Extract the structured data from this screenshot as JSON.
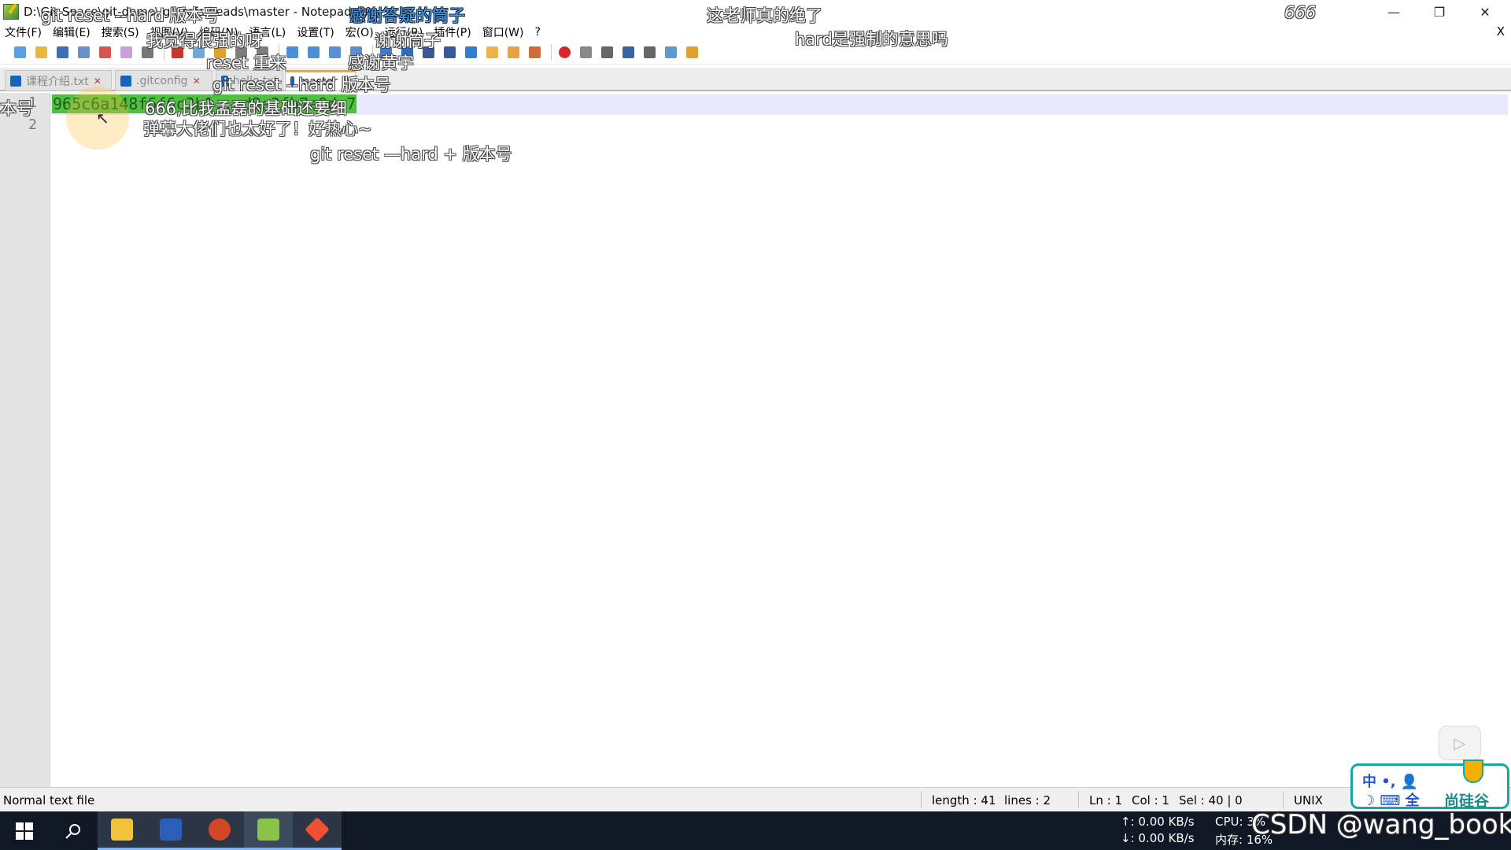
{
  "window": {
    "title": "D:\\Git-Space\\git-demo\\.git\\refs\\heads\\master - Notepad++",
    "minimize_icon": "minimize-icon",
    "restore_icon": "restore-icon",
    "close_icon": "close-icon"
  },
  "menu": {
    "items": [
      "文件(F)",
      "编辑(E)",
      "搜索(S)",
      "视图(V)",
      "编码(N)",
      "语言(L)",
      "设置(T)",
      "宏(O)",
      "运行(R)",
      "插件(P)",
      "窗口(W)",
      "?"
    ],
    "close_document": "X"
  },
  "toolbar": {
    "buttons": [
      "new-icon",
      "open-icon",
      "save-icon",
      "save-all-icon",
      "close-icon",
      "close-all-icon",
      "print-icon",
      "cut-icon",
      "copy-icon",
      "paste-icon",
      "undo-icon",
      "redo-icon",
      "find-icon",
      "replace-icon",
      "zoom-in-icon",
      "zoom-out-icon",
      "sync-icon",
      "wrap-icon",
      "show-all-icon",
      "indent-guide-icon",
      "doc-map-icon",
      "function-list-icon",
      "folder-workspace-icon",
      "monitor-icon",
      "record-macro-icon",
      "stop-macro-icon",
      "play-macro-icon",
      "run-macro-multiple-icon",
      "save-macro-icon",
      "window-icon",
      "folder-icon"
    ]
  },
  "tabs": [
    {
      "label": "课程介绍.txt",
      "active": false
    },
    {
      "label": ".gitconfig",
      "active": false
    },
    {
      "label": "hello.txt",
      "active": false
    },
    {
      "label": "master",
      "active": true
    }
  ],
  "editor": {
    "line_numbers": [
      "1",
      "2"
    ],
    "lines": [
      "965c6a148f6f6c2b1...d9e2fb7a0dc7",
      ""
    ],
    "selected_text": "965c6a148f6f6c2b1...d9e2fb7a0dc7"
  },
  "danmaku": [
    {
      "text": "git reset --hard 版本号",
      "color": "white"
    },
    {
      "text": "感谢答疑的筒子",
      "color": "blue"
    },
    {
      "text": "这老师真的绝了",
      "color": "white"
    },
    {
      "text": "666",
      "color": "white"
    },
    {
      "text": "hard是强制的意思吗",
      "color": "white"
    },
    {
      "text": "我觉得很强的呀",
      "color": "white"
    },
    {
      "text": "谢谢筒子",
      "color": "white"
    },
    {
      "text": "reset 重来",
      "color": "white"
    },
    {
      "text": "感谢黄宇",
      "color": "white"
    },
    {
      "text": "git reset --hard 版本号",
      "color": "white"
    },
    {
      "text": "本号",
      "color": "white"
    },
    {
      "text": "666,比我孟磊的基础还要细",
      "color": "white"
    },
    {
      "text": "弹幕大佬们也太好了！好热心~",
      "color": "white"
    },
    {
      "text": "git reset —hard + 版本号",
      "color": "white"
    }
  ],
  "status": {
    "file_type": "Normal text file",
    "length": "length : 41",
    "lines": "lines : 2",
    "ln": "Ln : 1",
    "col": "Col : 1",
    "sel": "Sel : 40 | 0",
    "eol": "UNIX"
  },
  "taskbar": {
    "upload": "↑: 0.00 KB/s",
    "download": "↓: 0.00 KB/s",
    "cpu": "CPU: 3%",
    "mem": "内存: 16%",
    "apps": [
      "windows-start-icon",
      "search-icon",
      "file-explorer-icon",
      "word-icon",
      "powerpoint-icon",
      "notepadpp-icon",
      "git-icon"
    ]
  },
  "overlay": {
    "watermark": "CSDN @wang_book",
    "brand": "尚硅谷",
    "ime_line1": "中 •, 👤",
    "ime_line2": "☽ ⌨ 全"
  },
  "colors": {
    "selection": "#50c040",
    "current_line": "#e8e8ff",
    "danmaku_blue": "#4fa3f7",
    "taskbar": "#101826"
  }
}
